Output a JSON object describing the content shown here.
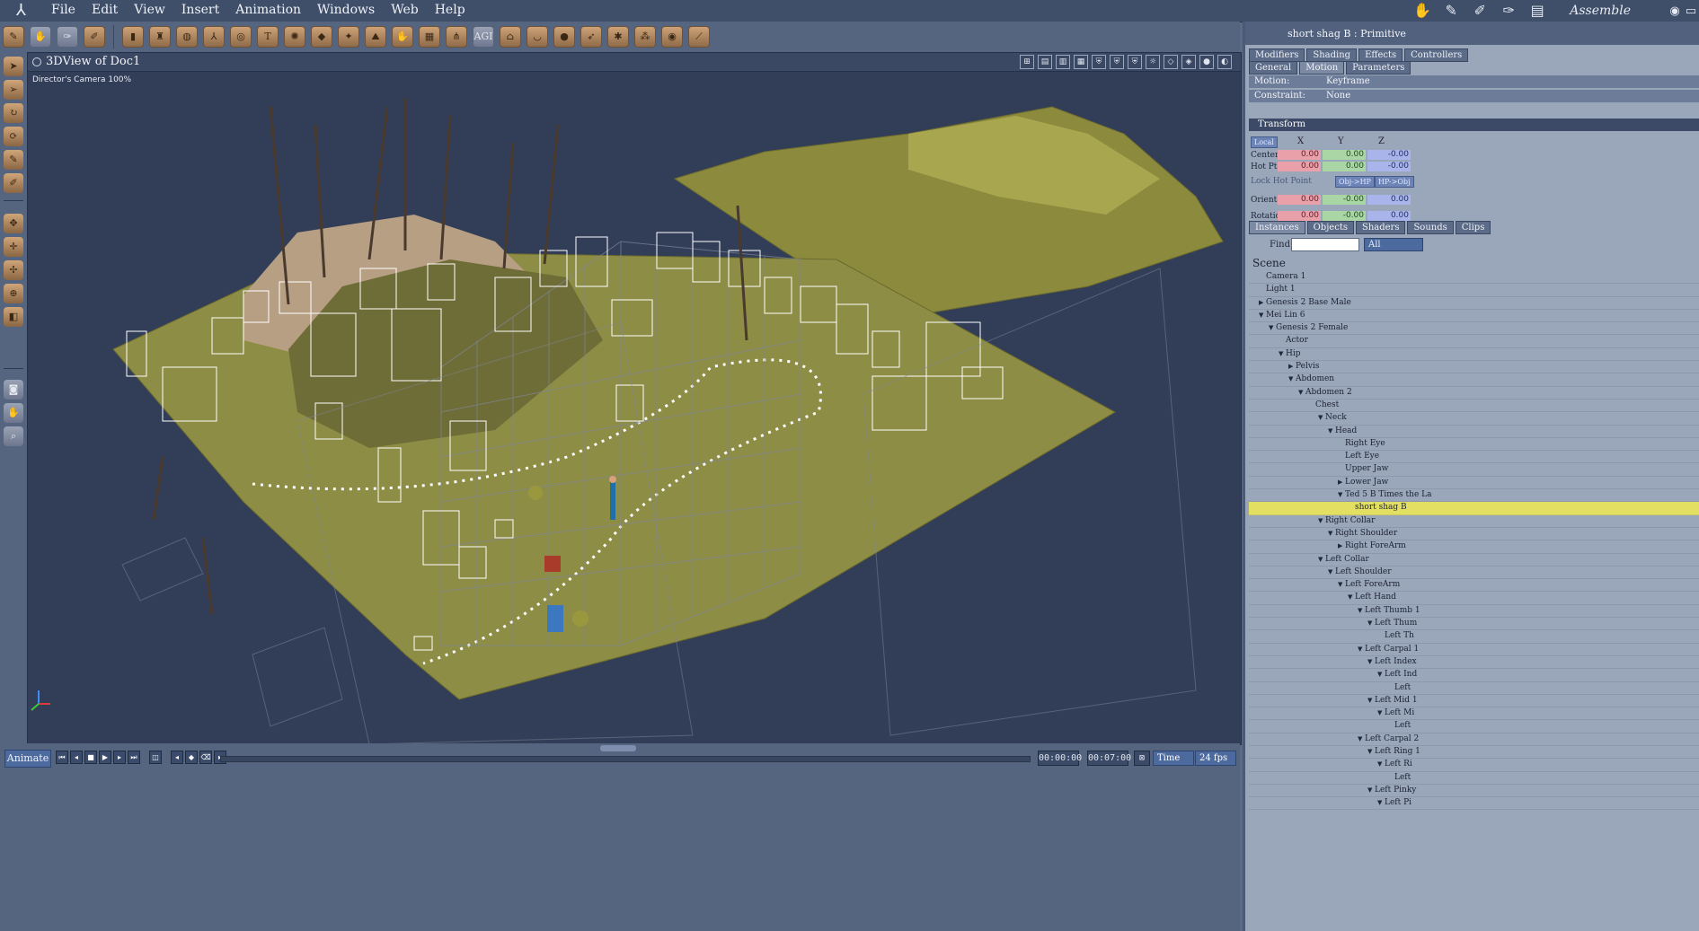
{
  "menubar": {
    "items": [
      "File",
      "Edit",
      "View",
      "Insert",
      "Animation",
      "Windows",
      "Web",
      "Help"
    ],
    "room_label": "Assemble"
  },
  "viewport": {
    "title": "3DView of Doc1",
    "camera_label": "Director's Camera 100%",
    "colors": {
      "background": "#323e57",
      "terrain": "#8e8d45",
      "wireframe": "#ffffff",
      "grid": "#7e879a"
    }
  },
  "animbar": {
    "animate_label": "Animate",
    "time_current": "00:00:00",
    "time_end": "00:07:00",
    "time_mode": "Time",
    "fps": "24 fps"
  },
  "rightpanel": {
    "title": "short shag B : Primitive",
    "tabs_top": [
      "Modifiers",
      "Shading",
      "Effects",
      "Controllers"
    ],
    "tabs_sub": [
      "General",
      "Motion",
      "Parameters"
    ],
    "motion_label": "Motion:",
    "motion_value": "Keyframe",
    "constraint_label": "Constraint:",
    "constraint_value": "None",
    "transform_label": "Transform",
    "space_label": "Local",
    "axes": [
      "X",
      "Y",
      "Z"
    ],
    "center_label": "Center",
    "center_values": [
      "0.00",
      "0.00",
      "-0.00"
    ],
    "hotpt_label": "Hot Pt.",
    "hotpt_values": [
      "0.00",
      "0.00",
      "-0.00"
    ],
    "lock_label": "Lock Hot Point",
    "obj_hp_label": "Obj->HP",
    "hp_obj_label": "HP->Obj",
    "orient_label": "Orient.",
    "orient_values": [
      "0.00",
      "-0.00",
      "0.00"
    ],
    "rotation_label": "Rotation",
    "rotation_values": [
      "0.00",
      "-0.00",
      "0.00"
    ]
  },
  "instances": {
    "tabs": [
      "Instances",
      "Objects",
      "Shaders",
      "Sounds",
      "Clips"
    ],
    "find_label": "Find:",
    "filter_value": "All",
    "scene_label": "Scene",
    "tree": [
      {
        "label": "Camera 1",
        "indent": 1,
        "tw": ""
      },
      {
        "label": "Light 1",
        "indent": 1,
        "tw": ""
      },
      {
        "label": "Genesis 2 Base Male",
        "indent": 1,
        "tw": "▶"
      },
      {
        "label": "Mei Lin 6",
        "indent": 1,
        "tw": "▼"
      },
      {
        "label": "Genesis 2 Female",
        "indent": 2,
        "tw": "▼"
      },
      {
        "label": "Actor",
        "indent": 3,
        "tw": ""
      },
      {
        "label": "Hip",
        "indent": 3,
        "tw": "▼"
      },
      {
        "label": "Pelvis",
        "indent": 4,
        "tw": "▶"
      },
      {
        "label": "Abdomen",
        "indent": 4,
        "tw": "▼"
      },
      {
        "label": "Abdomen 2",
        "indent": 5,
        "tw": "▼"
      },
      {
        "label": "Chest",
        "indent": 6,
        "tw": ""
      },
      {
        "label": "Neck",
        "indent": 7,
        "tw": "▼"
      },
      {
        "label": "Head",
        "indent": 8,
        "tw": "▼"
      },
      {
        "label": "Right Eye",
        "indent": 9,
        "tw": ""
      },
      {
        "label": "Left Eye",
        "indent": 9,
        "tw": ""
      },
      {
        "label": "Upper Jaw",
        "indent": 9,
        "tw": ""
      },
      {
        "label": "Lower Jaw",
        "indent": 9,
        "tw": "▶"
      },
      {
        "label": "Ted 5 B Times the La",
        "indent": 9,
        "tw": "▼"
      },
      {
        "label": "short shag B",
        "indent": 10,
        "tw": "",
        "selected": true
      },
      {
        "label": "Right Collar",
        "indent": 7,
        "tw": "▼"
      },
      {
        "label": "Right Shoulder",
        "indent": 8,
        "tw": "▼"
      },
      {
        "label": "Right ForeArm",
        "indent": 9,
        "tw": "▶"
      },
      {
        "label": "Left Collar",
        "indent": 7,
        "tw": "▼"
      },
      {
        "label": "Left Shoulder",
        "indent": 8,
        "tw": "▼"
      },
      {
        "label": "Left ForeArm",
        "indent": 9,
        "tw": "▼"
      },
      {
        "label": "Left Hand",
        "indent": 10,
        "tw": "▼"
      },
      {
        "label": "Left Thumb 1",
        "indent": 11,
        "tw": "▼"
      },
      {
        "label": "Left Thum",
        "indent": 12,
        "tw": "▼"
      },
      {
        "label": "Left Th",
        "indent": 13,
        "tw": ""
      },
      {
        "label": "Left Carpal 1",
        "indent": 11,
        "tw": "▼"
      },
      {
        "label": "Left Index",
        "indent": 12,
        "tw": "▼"
      },
      {
        "label": "Left Ind",
        "indent": 13,
        "tw": "▼"
      },
      {
        "label": "Left",
        "indent": 14,
        "tw": ""
      },
      {
        "label": "Left Mid 1",
        "indent": 12,
        "tw": "▼"
      },
      {
        "label": "Left Mi",
        "indent": 13,
        "tw": "▼"
      },
      {
        "label": "Left",
        "indent": 14,
        "tw": ""
      },
      {
        "label": "Left Carpal 2",
        "indent": 11,
        "tw": "▼"
      },
      {
        "label": "Left Ring 1",
        "indent": 12,
        "tw": "▼"
      },
      {
        "label": "Left Ri",
        "indent": 13,
        "tw": "▼"
      },
      {
        "label": "Left",
        "indent": 14,
        "tw": ""
      },
      {
        "label": "Left Pinky",
        "indent": 12,
        "tw": "▼"
      },
      {
        "label": "Left Pi",
        "indent": 13,
        "tw": "▼"
      }
    ]
  }
}
